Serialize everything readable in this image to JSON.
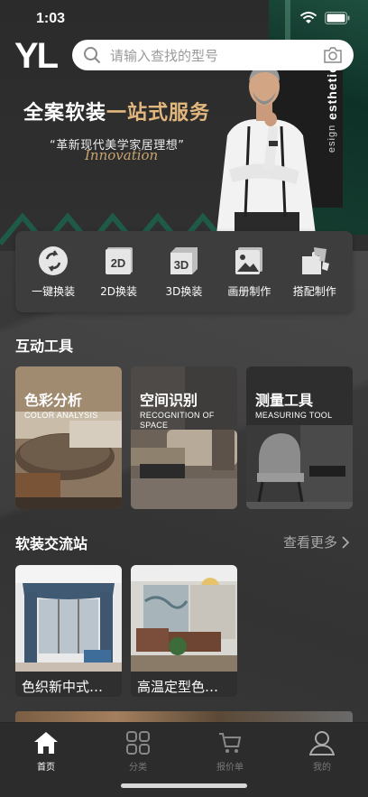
{
  "status_bar": {
    "time": "1:03"
  },
  "header": {
    "logo": "YL",
    "search_placeholder": "请输入查找的型号"
  },
  "hero": {
    "title_main": "全案软装",
    "title_accent": "一站式服务",
    "subtitle": "“革新现代美学家居理想”",
    "script_text": "Innovation",
    "vertical_small": "esign",
    "vertical_big": "esthetic"
  },
  "tools": [
    {
      "label": "一键换装",
      "icon": "swap-icon"
    },
    {
      "label": "2D换装",
      "icon": "2d-icon",
      "glyph": "2D"
    },
    {
      "label": "3D换装",
      "icon": "3d-icon",
      "glyph": "3D"
    },
    {
      "label": "画册制作",
      "icon": "album-icon"
    },
    {
      "label": "搭配制作",
      "icon": "puzzle-icon"
    }
  ],
  "interactive_section": {
    "title": "互动工具",
    "cards": [
      {
        "title": "色彩分析",
        "subtitle": "COLOR ANALYSIS"
      },
      {
        "title": "空间识别",
        "subtitle": "RECOGNITION OF SPACE"
      },
      {
        "title": "测量工具",
        "subtitle": "MEASURING TOOL"
      }
    ]
  },
  "exchange_section": {
    "title": "软装交流站",
    "more": "查看更多",
    "items": [
      {
        "label": "色织新中式…"
      },
      {
        "label": "高温定型色…"
      }
    ]
  },
  "tab_bar": [
    {
      "label": "首页",
      "icon": "home-icon",
      "active": true
    },
    {
      "label": "分类",
      "icon": "grid-icon",
      "active": false
    },
    {
      "label": "报价单",
      "icon": "cart-icon",
      "active": false
    },
    {
      "label": "我的",
      "icon": "user-icon",
      "active": false
    }
  ],
  "colors": {
    "accent_gold": "#e2b77e",
    "background": "#3a3a3a",
    "tab_active": "#ffffff",
    "tab_inactive": "#777777"
  }
}
